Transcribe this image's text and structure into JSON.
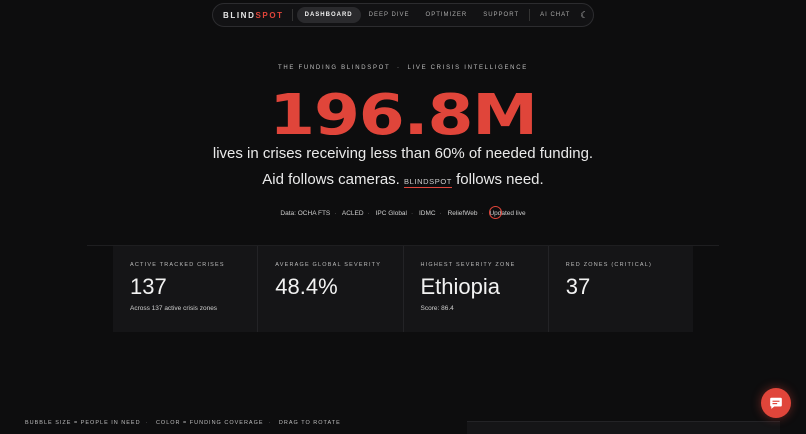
{
  "nav": {
    "brand_main": "BLIND",
    "brand_accent": "SPOT",
    "items": [
      {
        "label": "DASHBOARD",
        "active": true
      },
      {
        "label": "DEEP DIVE"
      },
      {
        "label": "OPTIMIZER"
      },
      {
        "label": "SUPPORT"
      },
      {
        "label": "AI CHAT"
      }
    ],
    "theme_icon": "moon-icon"
  },
  "hero": {
    "eyebrow": "THE FUNDING BLINDSPOT  ·  LIVE CRISIS INTELLIGENCE",
    "number": "196.8M",
    "line1": "lives in crises receiving less than 60% of needed funding.",
    "line2_pre": "Aid follows cameras.",
    "line2_brand": "BLINDSPOT",
    "line2_post": "follows need.",
    "sources": [
      "Data: OCHA FTS",
      "ACLED",
      "IPC Global",
      "IDMC",
      "ReliefWeb",
      "Updated live"
    ]
  },
  "stats": [
    {
      "label": "ACTIVE TRACKED CRISES",
      "value": "137",
      "sub": "Across 137 active crisis zones"
    },
    {
      "label": "AVERAGE GLOBAL SEVERITY",
      "value": "48.4%",
      "sub": ""
    },
    {
      "label": "HIGHEST SEVERITY ZONE",
      "value": "Ethiopia",
      "sub": "Score: 86.4"
    },
    {
      "label": "RED ZONES (CRITICAL)",
      "value": "37",
      "sub": ""
    }
  ],
  "legend": [
    "BUBBLE SIZE = PEOPLE IN NEED",
    "COLOR = FUNDING COVERAGE",
    "DRAG TO ROTATE"
  ],
  "colors": {
    "accent": "#e0453a",
    "background": "#0d0d0e",
    "card": "#151517"
  },
  "chat_icon": "chat-bubble-icon"
}
